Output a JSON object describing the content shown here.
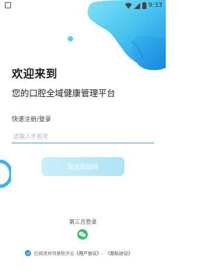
{
  "status_bar": {
    "time": "9:33",
    "wifi_icon": "wifi-icon",
    "signal_icon": "signal-icon",
    "battery_icon": "battery-icon"
  },
  "header": {
    "title": "欢迎来到",
    "subtitle": "您的口腔全域健康管理平台"
  },
  "form": {
    "section_label": "快速注册/登录",
    "phone_placeholder": "请输入手机号",
    "phone_value": "",
    "send_code_label": "发送验证码"
  },
  "third_party": {
    "label": "第三方登录",
    "wechat_icon": "wechat-icon"
  },
  "agreement": {
    "prefix": "已阅读并同意牧牙云",
    "user_agreement": "《用户协议》",
    "separator": "、",
    "privacy_policy": "《隐私协议》",
    "checked": true
  },
  "colors": {
    "accent": "#2ea7ec",
    "blob_light": "#5ed3f3",
    "blob_dark": "#1e8ee6",
    "button_bg": "#b8e8f6",
    "wechat": "#2cc161",
    "checkbox": "#3a8ee6"
  }
}
